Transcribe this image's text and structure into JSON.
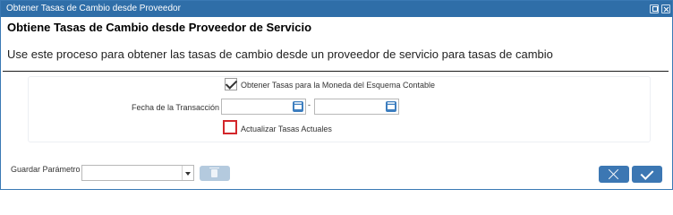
{
  "window": {
    "title": "Obtener Tasas de Cambio desde Proveedor"
  },
  "process": {
    "title": "Obtiene Tasas de Cambio desde Proveedor de Servicio",
    "description": "Use este proceso para obtener las tasas de cambio desde un proveedor de servicio para tasas de cambio"
  },
  "form": {
    "currency_scheme_checkbox": {
      "label": "Obtener Tasas para la Moneda del Esquema Contable",
      "checked": true
    },
    "transaction_date": {
      "label": "Fecha de la Transacción",
      "from_value": "",
      "to_value": "",
      "separator": "-"
    },
    "update_rates_checkbox": {
      "label": "Actualizar Tasas Actuales",
      "checked": false
    }
  },
  "footer": {
    "save_param_label": "Guardar Parámetro",
    "save_param_value": ""
  },
  "colors": {
    "titlebar": "#2f6ea8",
    "action_button": "#3c77b3",
    "focus_border": "#d3262b"
  }
}
